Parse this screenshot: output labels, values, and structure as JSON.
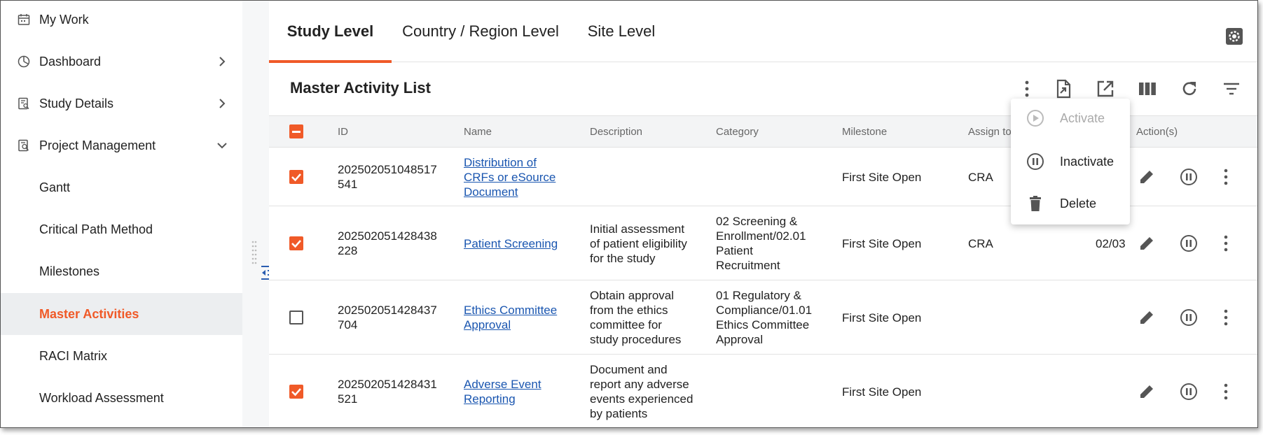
{
  "sidebar": {
    "items": [
      {
        "label": "My Work",
        "icon": "calendar-icon"
      },
      {
        "label": "Dashboard",
        "icon": "pie-chart-icon",
        "chevron": "right"
      },
      {
        "label": "Study Details",
        "icon": "document-search-icon",
        "chevron": "right"
      },
      {
        "label": "Project Management",
        "icon": "project-search-icon",
        "chevron": "down"
      },
      {
        "label": "Gantt"
      },
      {
        "label": "Critical Path Method"
      },
      {
        "label": "Milestones"
      },
      {
        "label": "Master Activities",
        "active": true
      },
      {
        "label": "RACI Matrix"
      },
      {
        "label": "Workload Assessment"
      }
    ]
  },
  "tabs": [
    {
      "label": "Study Level",
      "active": true
    },
    {
      "label": "Country / Region Level"
    },
    {
      "label": "Site Level"
    }
  ],
  "list": {
    "title": "Master Activity List"
  },
  "table": {
    "columns": [
      "ID",
      "Name",
      "Description",
      "Category",
      "Milestone",
      "Assign to",
      "Action(s)"
    ],
    "rows": [
      {
        "checked": true,
        "id_line1": "202502051048517",
        "id_line2": "541",
        "name": [
          "Distribution of",
          "CRFs or eSource",
          "Document"
        ],
        "description": [],
        "category": [],
        "milestone": "First Site Open",
        "assign": "CRA",
        "date": ""
      },
      {
        "checked": true,
        "id_line1": "202502051428438",
        "id_line2": "228",
        "name": [
          "Patient Screening"
        ],
        "description": [
          "Initial assessment",
          "of patient eligibility",
          "for the study"
        ],
        "category": [
          "02 Screening &",
          "Enrollment/02.01",
          "Patient",
          "Recruitment"
        ],
        "milestone": "First Site Open",
        "assign": "CRA",
        "date": "02/03"
      },
      {
        "checked": false,
        "id_line1": "202502051428437",
        "id_line2": "704",
        "name": [
          "Ethics Committee",
          "Approval"
        ],
        "description": [
          "Obtain approval",
          "from the ethics",
          "committee for",
          "study procedures"
        ],
        "category": [
          "01 Regulatory &",
          "Compliance/01.01",
          "Ethics Committee",
          "Approval"
        ],
        "milestone": "First Site Open",
        "assign": "",
        "date": ""
      },
      {
        "checked": true,
        "id_line1": "202502051428431",
        "id_line2": "521",
        "name": [
          "Adverse Event",
          "Reporting"
        ],
        "description": [
          "Document and",
          "report any adverse",
          "events experienced",
          "by patients"
        ],
        "category": [],
        "milestone": "First Site Open",
        "assign": "",
        "date": ""
      }
    ]
  },
  "menu": {
    "items": [
      {
        "label": "Activate",
        "icon": "play-circle-icon",
        "disabled": true
      },
      {
        "label": "Inactivate",
        "icon": "pause-circle-icon"
      },
      {
        "label": "Delete",
        "icon": "trash-icon"
      }
    ]
  },
  "colors": {
    "accent": "#f05a28",
    "link": "#1a56b0",
    "active_bg": "#eceef0",
    "header_bg": "#f3f4f5"
  }
}
